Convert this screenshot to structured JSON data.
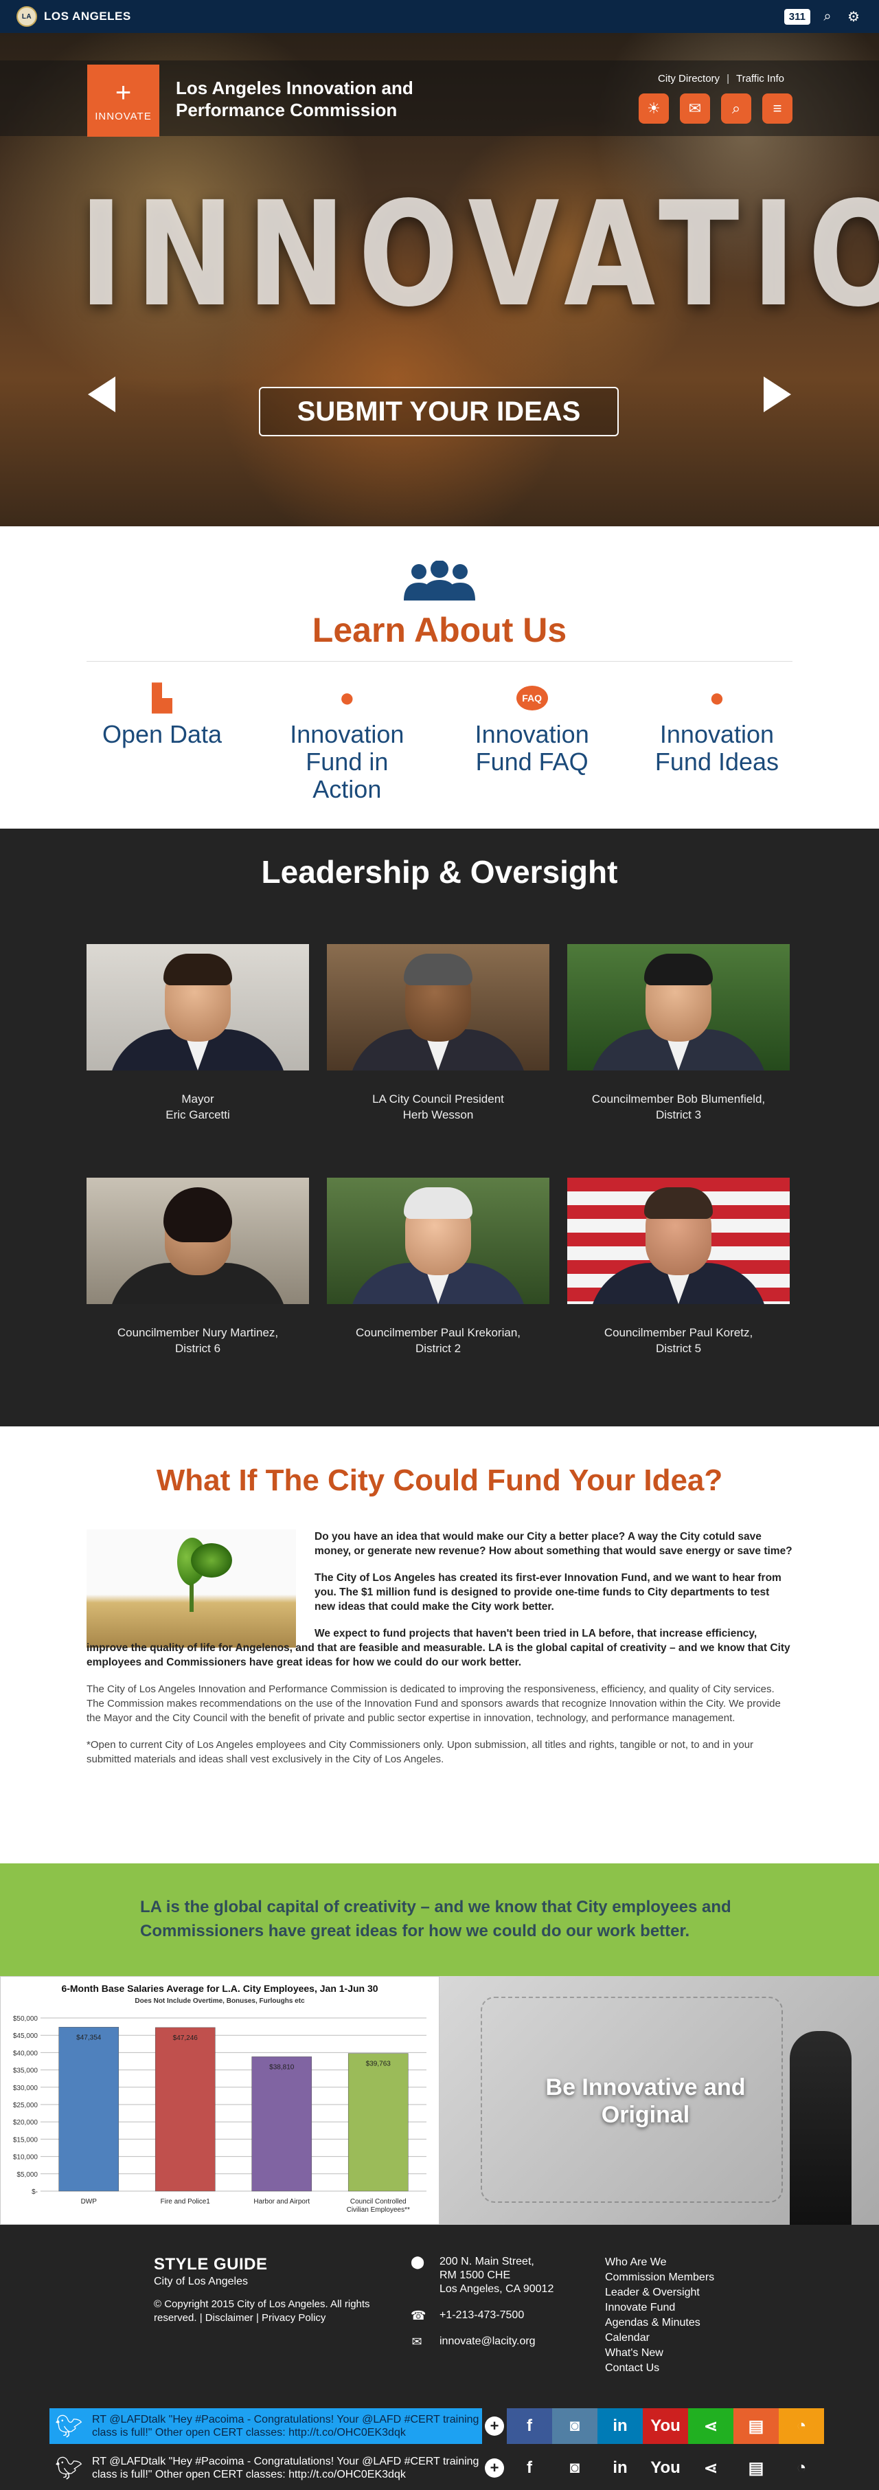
{
  "citybar": {
    "brand": "LOS ANGELES",
    "badge": "311"
  },
  "header": {
    "logo_word": "INNOVATE",
    "title": "Los Angeles Innovation and Performance Commission",
    "links": [
      "City Directory",
      "Traffic Info"
    ],
    "icons": [
      "weather-icon",
      "chat-icon",
      "search-doc-icon",
      "menu-icon"
    ]
  },
  "hero": {
    "word": "INNOVATION",
    "cta": "SUBMIT YOUR IDEAS"
  },
  "learn": {
    "title": "Learn About Us",
    "links": [
      {
        "label": "Open Data",
        "icon": "bar-chart-icon"
      },
      {
        "label": "Innovation Fund in Action",
        "icon": "piggy-bank-icon"
      },
      {
        "label": "Innovation Fund FAQ",
        "icon": "faq-icon",
        "badge": "FAQ"
      },
      {
        "label": "Innovation Fund Ideas",
        "icon": "lightbulb-icon"
      }
    ]
  },
  "leadership": {
    "title": "Leadership & Oversight",
    "people": [
      {
        "line1": "Mayor",
        "line2": "Eric Garcetti"
      },
      {
        "line1": "LA City Council President",
        "line2": "Herb Wesson"
      },
      {
        "line1": "Councilmember Bob Blumenfield,",
        "line2": "District 3"
      },
      {
        "line1": "Councilmember Nury Martinez,",
        "line2": "District 6"
      },
      {
        "line1": "Councilmember Paul Krekorian,",
        "line2": "District 2"
      },
      {
        "line1": "Councilmember Paul Koretz,",
        "line2": "District 5"
      }
    ]
  },
  "fund": {
    "title": "What If The City Could Fund Your Idea?",
    "p1": "Do you have an idea that would make our City a better place? A way the City cotuld save money, or generate new revenue?  How about something that would save energy or save time?",
    "p2": "The City of Los Angeles has created its first-ever Innovation Fund, and we want to hear from you.  The $1 million fund is designed to provide one-time funds to City departments to test new ideas that could make the City work better.",
    "p3": "We expect to fund projects that haven't been tried in LA before, that increase efficiency, improve the quality of life for Angelenos, and that are feasible and measurable.  LA is the global capital of creativity – and we know that City employees and Commissioners have great ideas for how we could do our work better.",
    "p4": "The City of Los Angeles Innovation and Performance Commission is dedicated to improving the responsiveness, efficiency, and quality of City services. The Commission makes recommendations on the use of the Innovation Fund and sponsors awards that recognize Innovation within the City. We provide the Mayor and the City Council with the benefit of private and public sector expertise in innovation, technology, and performance management.",
    "p5": " *Open to current City of Los Angeles employees and City Commissioners only. Upon submission, all titles and rights, tangible or not, to and in your submitted materials and ideas shall vest exclusively in the City of Los Angeles."
  },
  "quote": {
    "text": "LA is the global capital of creativity – and we know that City employees and Commissioners have great ideas for how we could do our work better."
  },
  "chart_data": {
    "type": "bar",
    "title": "6-Month Base Salaries Average for L.A. City Employees, Jan 1-Jun 30",
    "subtitle": "Does Not Include Overtime, Bonuses, Furloughs etc",
    "categories": [
      "DWP",
      "Fire and Police1",
      "Harbor and Airport",
      "Council Controlled Civilian Employees**"
    ],
    "values": [
      47354,
      47246,
      38810,
      39763
    ],
    "value_labels": [
      "$47,354",
      "$47,246",
      "$38,810",
      "$39,763"
    ],
    "colors": [
      "#4f81bd",
      "#c0504d",
      "#8064a2",
      "#9bbb59"
    ],
    "ylim": [
      0,
      50000
    ],
    "yticks": [
      "$-",
      "$5,000",
      "$10,000",
      "$15,000",
      "$20,000",
      "$25,000",
      "$30,000",
      "$35,000",
      "$40,000",
      "$45,000",
      "$50,000"
    ],
    "grid": true
  },
  "idea_image": {
    "caption": "Be Innovative and Original"
  },
  "footer": {
    "style_guide": "STYLE GUIDE",
    "sub": "City of Los Angeles",
    "copyright": "© Copyright 2015 City of Los Angeles. All rights reserved.",
    "disclaimer": "Disclaimer",
    "privacy": "Privacy Policy",
    "address": [
      "200 N. Main Street,",
      "RM 1500 CHE",
      "Los Angeles, CA 90012"
    ],
    "phone": "+1-213-473-7500",
    "email": "innovate@lacity.org",
    "links": [
      "Who Are We",
      "Commission Members",
      "Leader & Oversight",
      "Innovate Fund",
      "Agendas & Minutes",
      "Calendar",
      "What's New",
      "Contact Us"
    ]
  },
  "tweet": {
    "text": "RT @LAFDtalk \"Hey #Pacoima - Congratulations! Your @LAFD #CERT training class is full!\" Other open CERT classes: http://t.co/OHC0EK3dqk"
  },
  "social": [
    {
      "name": "add-icon",
      "glyph": "+",
      "color": "#242424"
    },
    {
      "name": "facebook-icon",
      "glyph": "f",
      "color": "#3b5998"
    },
    {
      "name": "instagram-icon",
      "glyph": "◙",
      "color": "#517fa4"
    },
    {
      "name": "linkedin-icon",
      "glyph": "in",
      "color": "#007bb6"
    },
    {
      "name": "youtube-icon",
      "glyph": "You",
      "color": "#cd201f"
    },
    {
      "name": "share-icon",
      "glyph": "⋖",
      "color": "#21b021"
    },
    {
      "name": "comment-icon",
      "glyph": "▤",
      "color": "#e8612c"
    },
    {
      "name": "rss-icon",
      "glyph": "◔",
      "color": "#f39c12"
    }
  ]
}
